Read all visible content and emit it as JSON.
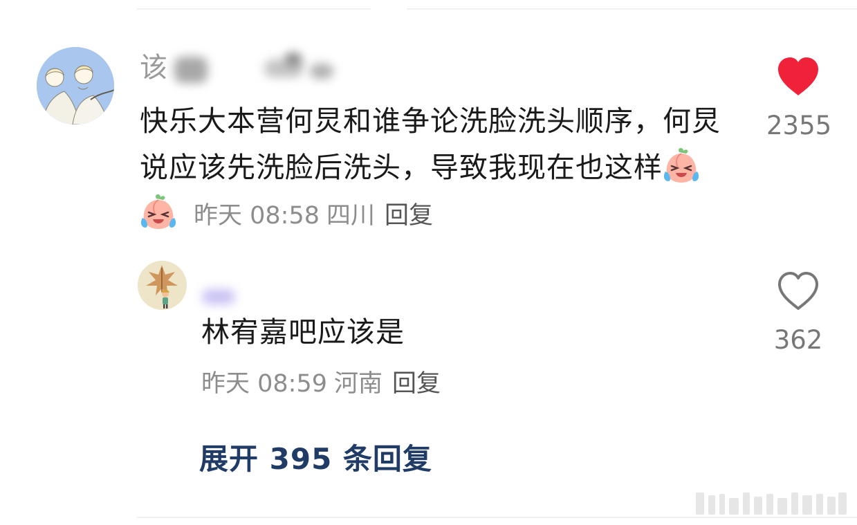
{
  "main_comment": {
    "username_visible": "该",
    "text": "快乐大本营何炅和谁争论洗脸洗头顺序，何炅说应该先洗脸后洗头，导致我现在也这样",
    "emojis": [
      "crying-laughing-peach-icon",
      "crying-laughing-peach-icon"
    ],
    "time": "昨天 08:58",
    "location": "四川",
    "reply_label": "回复",
    "like_count": "2355",
    "liked": true,
    "like_color": "#f0223a"
  },
  "sub_comment": {
    "text": "林宥嘉吧应该是",
    "time": "昨天 08:59",
    "location": "河南",
    "reply_label": "回复",
    "like_count": "362",
    "liked": false
  },
  "expand": {
    "label": "展开 395 条回复",
    "color": "#1f3b66"
  }
}
